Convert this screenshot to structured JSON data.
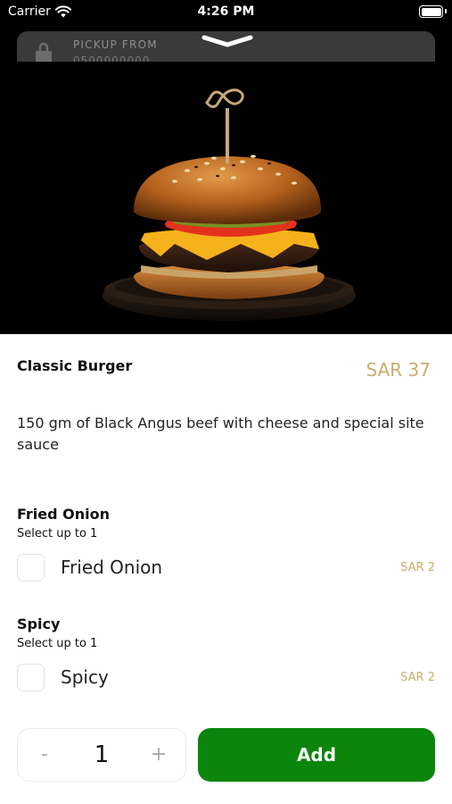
{
  "status_bar": {
    "carrier": "Carrier",
    "time": "4:26 PM"
  },
  "pickup": {
    "label": "PICKUP FROM",
    "sub_text": "0500000000",
    "icon": "store-bag-icon"
  },
  "product": {
    "name": "Classic Burger",
    "price": "SAR 37",
    "description": "150 gm of Black Angus beef with cheese and special site sauce",
    "image": "burger-photo"
  },
  "option_groups": [
    {
      "title": "Fried Onion",
      "subtitle": "Select up to 1",
      "options": [
        {
          "label": "Fried Onion",
          "price": "SAR 2",
          "checked": false
        }
      ]
    },
    {
      "title": "Spicy",
      "subtitle": "Select up to 1",
      "options": [
        {
          "label": "Spicy",
          "price": "SAR 2",
          "checked": false
        }
      ]
    }
  ],
  "cart": {
    "minus": "-",
    "quantity": "1",
    "plus": "+",
    "add_label": "Add"
  },
  "colors": {
    "accent_gold": "#c9ad6b",
    "add_green": "#0b850b"
  }
}
